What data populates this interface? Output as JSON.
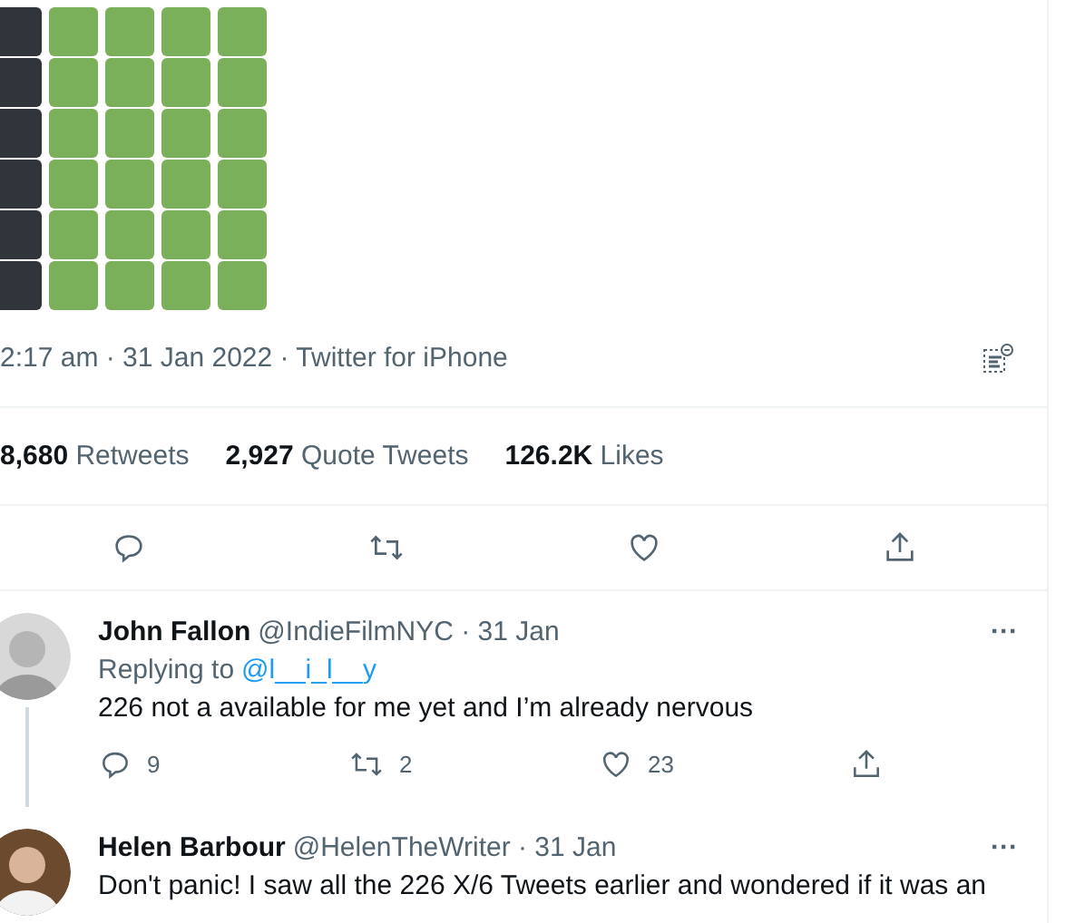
{
  "grid": {
    "rows": [
      [
        {
          "color": "#30343b"
        },
        {
          "color": "#79b059"
        },
        {
          "color": "#79b059"
        },
        {
          "color": "#79b059"
        },
        {
          "color": "#79b059"
        }
      ],
      [
        {
          "color": "#30343b"
        },
        {
          "color": "#79b059"
        },
        {
          "color": "#79b059"
        },
        {
          "color": "#79b059"
        },
        {
          "color": "#79b059"
        }
      ],
      [
        {
          "color": "#30343b"
        },
        {
          "color": "#79b059"
        },
        {
          "color": "#79b059"
        },
        {
          "color": "#79b059"
        },
        {
          "color": "#79b059"
        }
      ],
      [
        {
          "color": "#30343b"
        },
        {
          "color": "#79b059"
        },
        {
          "color": "#79b059"
        },
        {
          "color": "#79b059"
        },
        {
          "color": "#79b059"
        }
      ],
      [
        {
          "color": "#30343b"
        },
        {
          "color": "#79b059"
        },
        {
          "color": "#79b059"
        },
        {
          "color": "#79b059"
        },
        {
          "color": "#79b059"
        }
      ],
      [
        {
          "color": "#30343b"
        },
        {
          "color": "#79b059"
        },
        {
          "color": "#79b059"
        },
        {
          "color": "#79b059"
        },
        {
          "color": "#79b059"
        }
      ]
    ]
  },
  "tweet": {
    "meta": "2:17 am · 31 Jan 2022 · Twitter for iPhone",
    "stats": [
      {
        "count": "8,680",
        "label": "Retweets"
      },
      {
        "count": "2,927",
        "label": "Quote Tweets"
      },
      {
        "count": "126.2K",
        "label": "Likes"
      }
    ]
  },
  "replies": [
    {
      "name": "John Fallon",
      "handle": "@IndieFilmNYC · 31 Jan",
      "more": "···",
      "replying_prefix": "Replying to",
      "replying_handle": "@l__i_l__y",
      "text": "226 not a available for me yet and I’m already nervous",
      "thread_line": true,
      "counts": {
        "reply": "9",
        "retweet": "2",
        "like": "23"
      }
    },
    {
      "name": "Helen Barbour",
      "handle": "@HelenTheWriter · 31 Jan",
      "more": "···",
      "text": "Don't panic! I saw all the 226 X/6 Tweets earlier and wondered if it was an",
      "thread_line": false
    }
  ]
}
